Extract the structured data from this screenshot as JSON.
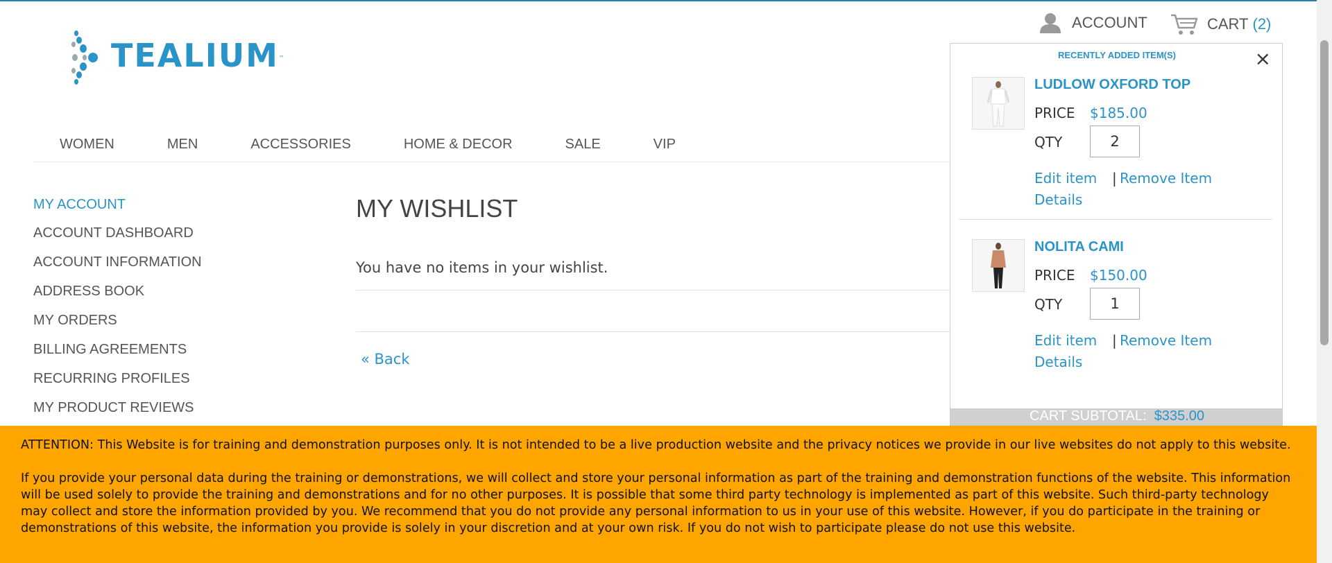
{
  "brand": {
    "name": "TEALIUM",
    "trademark": "™"
  },
  "header": {
    "account_label": "ACCOUNT",
    "cart_label": "CART",
    "cart_count": "(2)"
  },
  "nav": {
    "items": [
      "WOMEN",
      "MEN",
      "ACCESSORIES",
      "HOME & DECOR",
      "SALE",
      "VIP"
    ]
  },
  "sidebar": {
    "title": "MY ACCOUNT",
    "items": [
      "ACCOUNT DASHBOARD",
      "ACCOUNT INFORMATION",
      "ADDRESS BOOK",
      "MY ORDERS",
      "BILLING AGREEMENTS",
      "RECURRING PROFILES",
      "MY PRODUCT REVIEWS"
    ]
  },
  "main": {
    "title": "MY WISHLIST",
    "empty_message": "You have no items in your wishlist.",
    "back_link": "« Back"
  },
  "cart_dropdown": {
    "heading": "RECENTLY ADDED ITEM(S)",
    "close_symbol": "×",
    "price_label": "PRICE",
    "qty_label": "QTY",
    "edit_label": "Edit item",
    "separator": "|",
    "remove_label": "Remove Item",
    "details_label": "Details",
    "items": [
      {
        "name": "LUDLOW OXFORD TOP",
        "price": "$185.00",
        "qty": "2"
      },
      {
        "name": "NOLITA CAMI",
        "price": "$150.00",
        "qty": "1"
      }
    ],
    "subtotal_label": "CART SUBTOTAL:",
    "subtotal_value": "$335.00"
  },
  "notice": {
    "paragraph1": "ATTENTION: This Website is for training and demonstration purposes only. It is not intended to be a live production website and the privacy notices we provide in our live websites do not apply to this website.",
    "paragraph2": "If you provide your personal data during the training or demonstrations, we will collect and store your personal information as part of the training and demonstration functions of the website. This information will be used solely to provide the training and demonstrations and for no other purposes. It is possible that some third party technology is implemented as part of this website. Such third-party technology may collect and store the information provided by you. We recommend that you do not provide any personal information to us in your use of this website. However, if you do participate in the training or demonstrations of this website, the information you provide is solely in your discretion and at your own risk. If you do not wish to participate please do not use this website."
  },
  "colors": {
    "accent": "#2a93c8",
    "notice_bg": "#ffa500",
    "text": "#555555"
  }
}
